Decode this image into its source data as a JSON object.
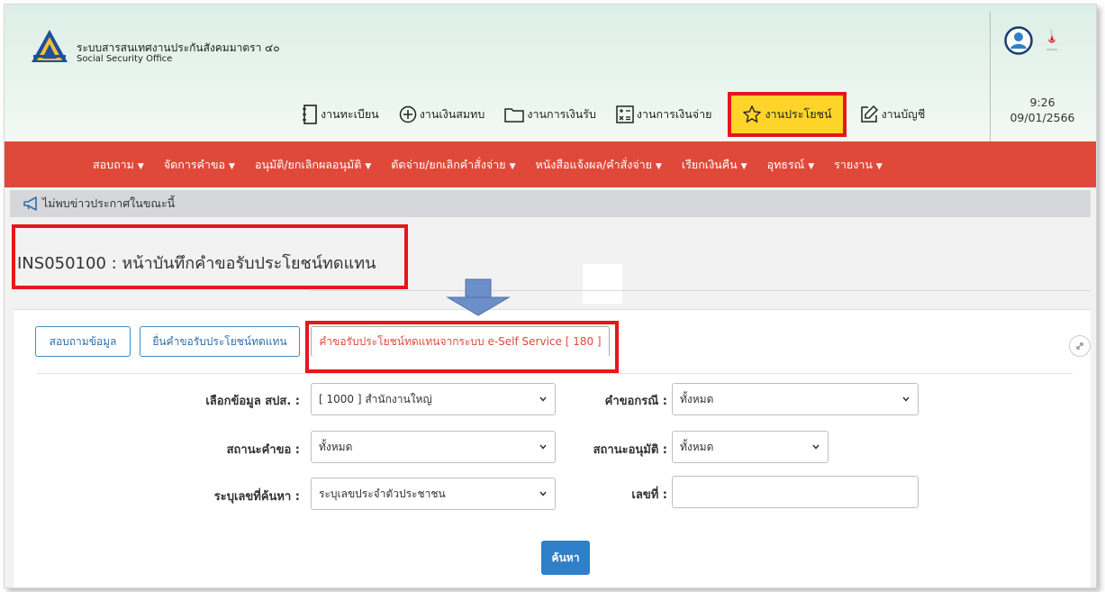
{
  "brand": {
    "name_th": "ระบบสารสนเทศงานประกันสังคมมาตรา ๔๐",
    "name_en": "Social Security Office"
  },
  "modules": [
    {
      "label": "งานทะเบียน",
      "icon": "notebook-icon"
    },
    {
      "label": "งานเงินสมทบ",
      "icon": "plus-circle-icon"
    },
    {
      "label": "งานการเงินรับ",
      "icon": "folder-icon"
    },
    {
      "label": "งานการเงินจ่าย",
      "icon": "calculator-icon"
    },
    {
      "label": "งานประโยชน์",
      "icon": "star-icon",
      "active": true
    },
    {
      "label": "งานบัญชี",
      "icon": "edit-icon"
    }
  ],
  "datetime": {
    "time": "9:26",
    "date": "09/01/2566"
  },
  "nav": [
    "สอบถาม",
    "จัดการคำขอ",
    "อนุมัติ/ยกเลิกผลอนุมัติ",
    "ตัดจ่าย/ยกเลิกคำสั่งจ่าย",
    "หนังสือแจ้งผล/คำสั่งจ่าย",
    "เรียกเงินคืน",
    "อุทธรณ์",
    "รายงาน"
  ],
  "announcement": "ไม่พบข่าวประกาศในขณะนี้",
  "page_title": "INS050100 : หน้าบันทึกคำขอรับประโยชน์ทดแทน",
  "tabs": [
    {
      "label": "สอบถามข้อมูล"
    },
    {
      "label": "ยื่นคำขอรับประโยชน์ทดแทน"
    },
    {
      "label": "คำขอรับประโยชน์ทดแทนจากระบบ e-Self Service [ 180 ]",
      "active": true
    }
  ],
  "form": {
    "branch_label": "เลือกข้อมูล สปส. :",
    "branch_value": "[ 1000 ] สำนักงานใหญ่",
    "case_label": "คำขอกรณี :",
    "case_value": "ทั้งหมด",
    "request_status_label": "สถานะคำขอ :",
    "request_status_value": "ทั้งหมด",
    "approval_status_label": "สถานะอนุมัติ :",
    "approval_status_value": "ทั้งหมด",
    "search_by_label": "ระบุเลขที่ค้นหา :",
    "search_by_value": "ระบุเลขประจำตัวประชาชน",
    "number_label": "เลขที่ :",
    "number_value": "",
    "search_button": "ค้นหา"
  },
  "colors": {
    "nav_bg": "#e0493a",
    "active_module_bg": "#ffd42a",
    "highlight_red": "#e6161b",
    "primary_blue": "#2f80c9"
  }
}
